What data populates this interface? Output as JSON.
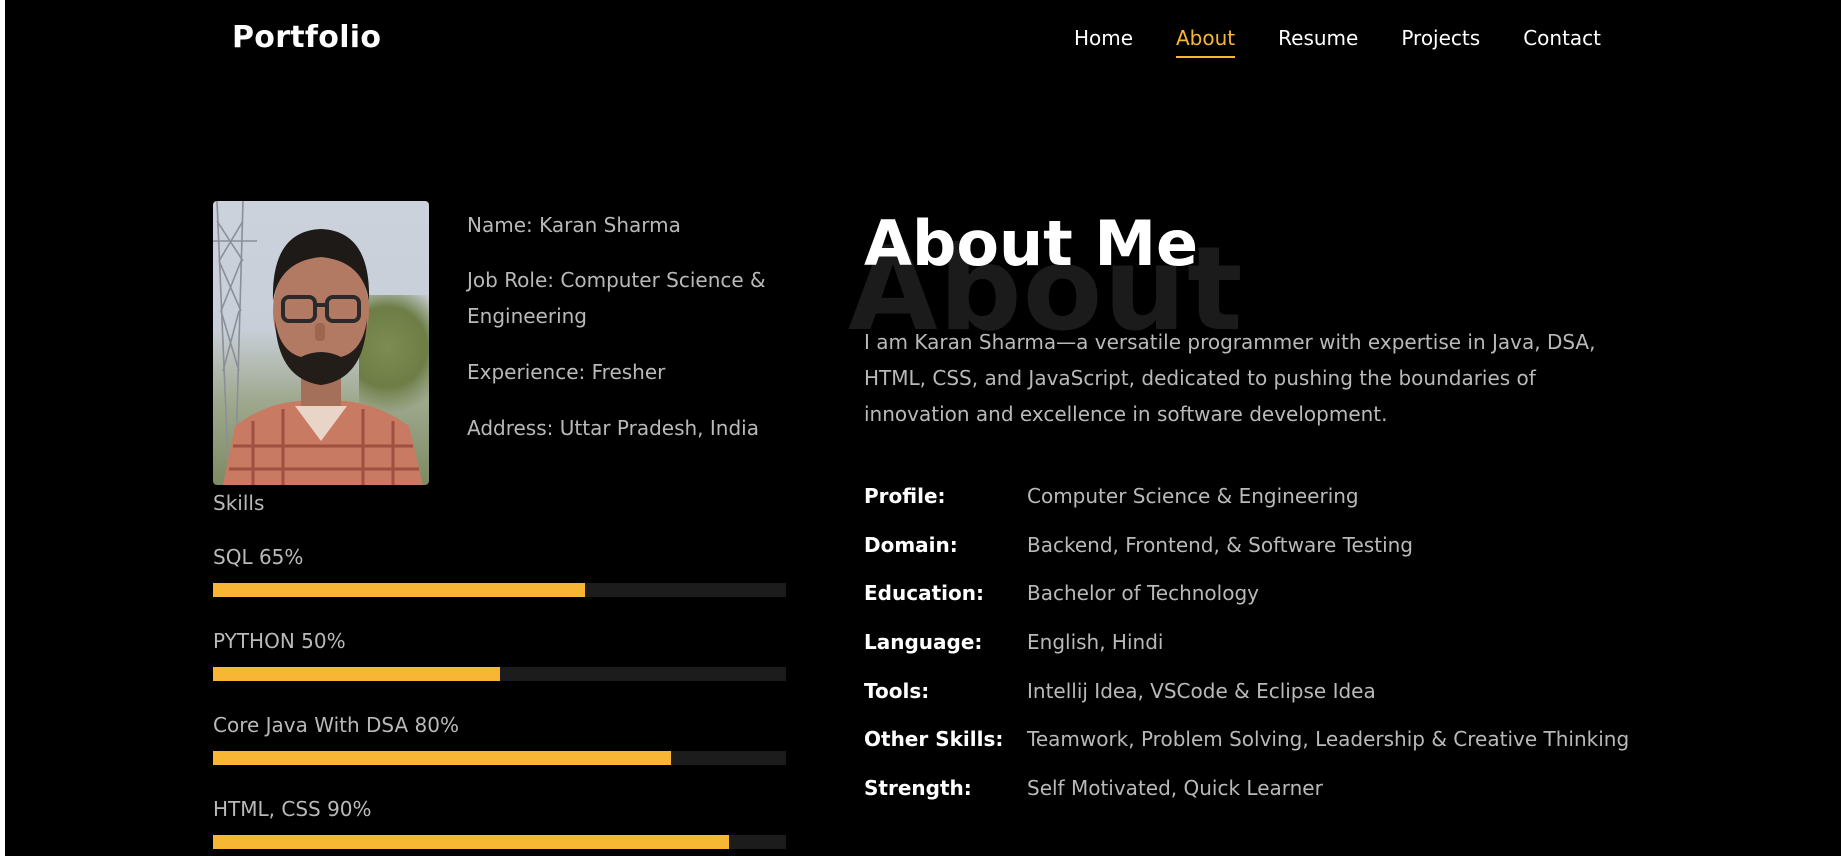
{
  "header": {
    "brand": "Portfolio",
    "nav": [
      {
        "label": "Home",
        "active": false
      },
      {
        "label": "About",
        "active": true
      },
      {
        "label": "Resume",
        "active": false
      },
      {
        "label": "Projects",
        "active": false
      },
      {
        "label": "Contact",
        "active": false
      }
    ]
  },
  "profile_info": {
    "name": "Name: Karan Sharma",
    "job_role": "Job Role: Computer Science & Engineering",
    "experience": "Experience: Fresher",
    "address": "Address: Uttar Pradesh, India"
  },
  "skills": {
    "title": "Skills",
    "items": [
      {
        "label": "SQL 65%",
        "percent": 65
      },
      {
        "label": "PYTHON 50%",
        "percent": 50
      },
      {
        "label": "Core Java With DSA 80%",
        "percent": 80
      },
      {
        "label": "HTML, CSS 90%",
        "percent": 90
      }
    ]
  },
  "about": {
    "background_word": "About",
    "title": "About Me",
    "text": "I am Karan Sharma—a versatile programmer with expertise in Java, DSA, HTML, CSS, and JavaScript, dedicated to pushing the boundaries of innovation and excellence in software development.",
    "details": [
      {
        "key": "Profile:",
        "value": "Computer Science & Engineering"
      },
      {
        "key": "Domain:",
        "value": "Backend, Frontend, & Software Testing"
      },
      {
        "key": "Education:",
        "value": "Bachelor of Technology"
      },
      {
        "key": "Language:",
        "value": "English, Hindi"
      },
      {
        "key": "Tools:",
        "value": "Intellij Idea, VSCode & Eclipse Idea"
      },
      {
        "key": "Other Skills:",
        "value": "Teamwork, Problem Solving, Leadership & Creative Thinking"
      },
      {
        "key": "Strength:",
        "value": "Self Motivated, Quick Learner"
      }
    ]
  },
  "colors": {
    "accent": "#f7b734",
    "background": "#000000",
    "text_muted": "#b9b9b9",
    "track": "#1c1c1c"
  }
}
